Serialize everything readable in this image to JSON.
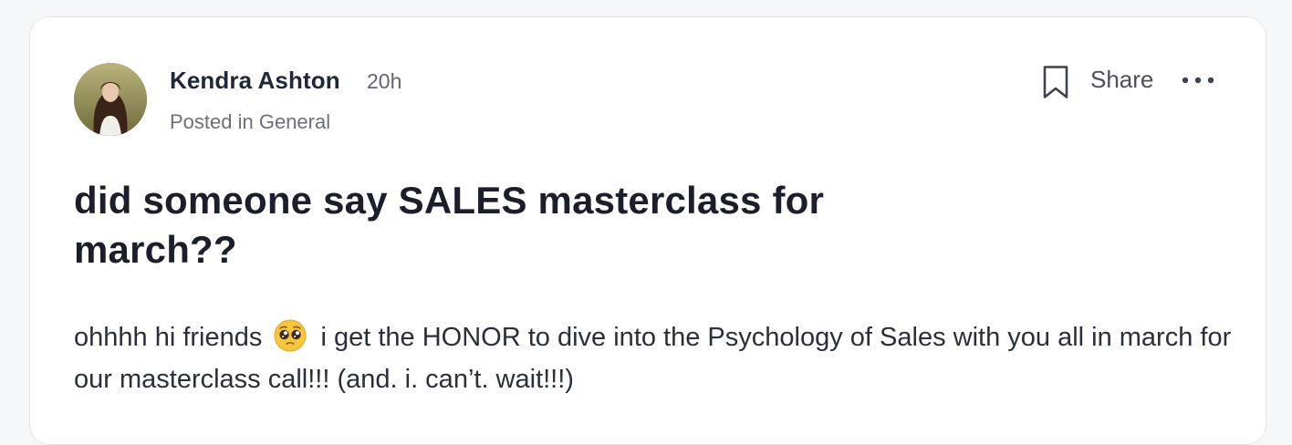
{
  "post": {
    "author": {
      "name": "Kendra Ashton",
      "time_ago": "20h",
      "avatar_icon": "user-avatar-photo"
    },
    "posted_in": "Posted in General",
    "actions": {
      "bookmark_icon": "bookmark-icon",
      "share_label": "Share",
      "more_icon": "more-horizontal-icon"
    },
    "title": "did someone say SALES masterclass for march??",
    "body": {
      "before_emoji": "ohhhh hi friends",
      "emoji": "pleading-face-emoji",
      "after_emoji": "i get the HONOR to dive into the Psychology of Sales with you all in march for our masterclass call!!! (and. i. can’t. wait!!!)"
    }
  },
  "colors": {
    "page_background": "#f6f7f9",
    "card_background": "#ffffff",
    "card_border": "#e3e5ea",
    "text_primary": "#1f2838",
    "text_secondary": "#6a707c"
  }
}
